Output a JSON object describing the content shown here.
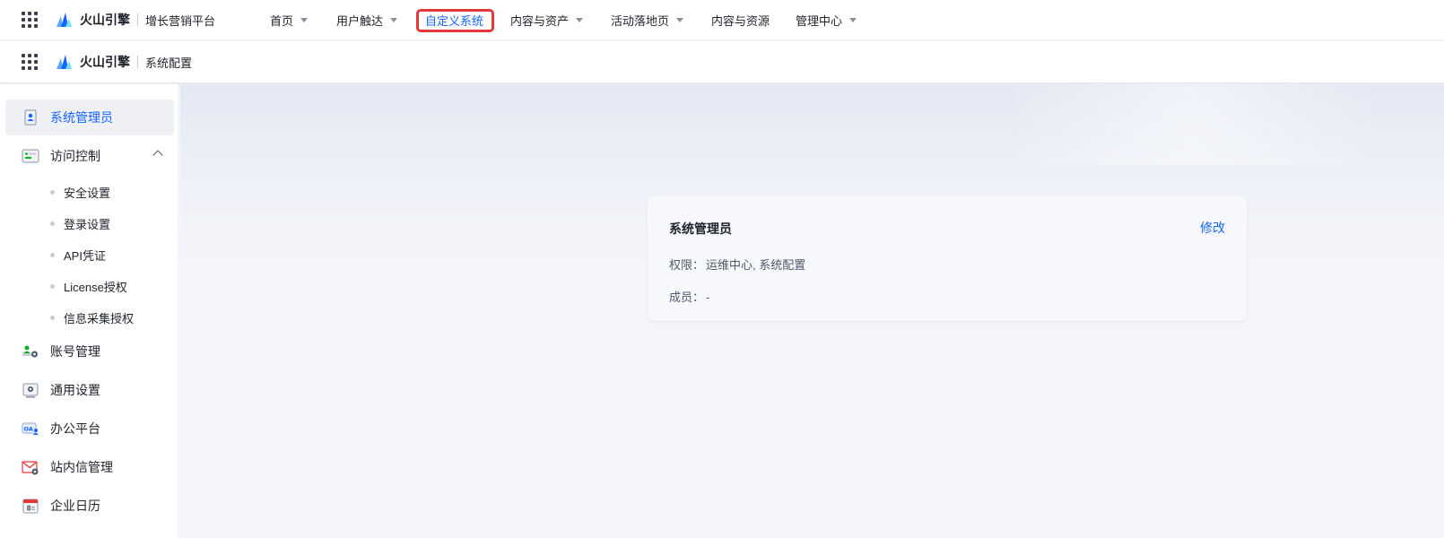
{
  "topbar": {
    "brand": "火山引擎",
    "product": "增长营销平台",
    "nav": [
      {
        "label": "首页",
        "dropdown": true
      },
      {
        "label": "用户触达",
        "dropdown": true
      },
      {
        "label": "自定义系统",
        "dropdown": false,
        "active": true
      },
      {
        "label": "内容与资产",
        "dropdown": true
      },
      {
        "label": "活动落地页",
        "dropdown": true
      },
      {
        "label": "内容与资源",
        "dropdown": false
      },
      {
        "label": "管理中心",
        "dropdown": true
      }
    ]
  },
  "subbar": {
    "brand": "火山引擎",
    "product": "系统配置"
  },
  "sidebar": {
    "items": [
      {
        "label": "系统管理员",
        "icon": "admin-user-icon",
        "selected": true
      },
      {
        "label": "访问控制",
        "icon": "access-control-icon",
        "expanded": true
      },
      {
        "label": "账号管理",
        "icon": "account-settings-icon"
      },
      {
        "label": "通用设置",
        "icon": "general-settings-icon"
      },
      {
        "label": "办公平台",
        "icon": "office-platform-icon"
      },
      {
        "label": "站内信管理",
        "icon": "mail-settings-icon"
      },
      {
        "label": "企业日历",
        "icon": "calendar-icon"
      }
    ],
    "sub_items": [
      "安全设置",
      "登录设置",
      "API凭证",
      "License授权",
      "信息采集授权"
    ]
  },
  "card": {
    "title": "系统管理员",
    "edit": "修改",
    "permission_label": "权限：",
    "permission_value": "运维中心, 系统配置",
    "members_label": "成员：",
    "members_value": "-"
  },
  "colors": {
    "accent": "#1664ff",
    "highlight_box": "#e6373a"
  }
}
